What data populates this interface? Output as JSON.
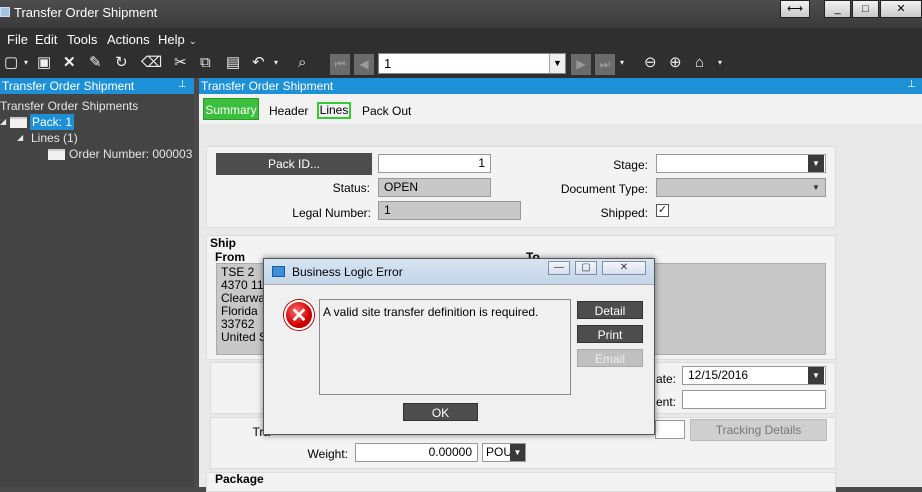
{
  "window": {
    "title": "Transfer Order Shipment",
    "controls": {
      "resize": "⟷",
      "minimize": "_",
      "maximize": "□",
      "close": "✕"
    }
  },
  "menu": [
    "File",
    "Edit",
    "Tools",
    "Actions",
    "Help"
  ],
  "toolbar": {
    "record_value": "1"
  },
  "tree": {
    "header": "Transfer Order Shipment",
    "root": "Transfer Order Shipments",
    "pack": "Pack: 1",
    "lines": "Lines (1)",
    "order": "Order Number: 000003"
  },
  "panel": {
    "header": "Transfer Order Shipment",
    "tabs": [
      "Summary",
      "Header",
      "Lines",
      "Pack Out"
    ]
  },
  "form": {
    "packid_button": "Pack ID...",
    "packid_value": "1",
    "status_label": "Status:",
    "status_value": "OPEN",
    "legal_label": "Legal Number:",
    "legal_value": "1",
    "stage_label": "Stage:",
    "stage_value": "",
    "doctype_label": "Document Type:",
    "doctype_value": "",
    "shipped_label": "Shipped:",
    "shipped_checked": true,
    "ship_section": "Ship",
    "from_label": "From",
    "to_label": "To",
    "from_address": [
      "TSE 2",
      "4370 112",
      "Clearwa",
      "Florida",
      "33762",
      "United S"
    ],
    "date_label_partial": "ate:",
    "date_value": "12/15/2016",
    "ent_label_partial": "ent:",
    "tracking_label_partial": "Tra",
    "tracking_details_button": "Tracking Details",
    "weight_label": "Weight:",
    "weight_value": "0.00000",
    "weight_unit": "POU",
    "package_section": "Package"
  },
  "dialog": {
    "title": "Business Logic Error",
    "message": "A valid site transfer definition is required.",
    "buttons": {
      "detail": "Detail",
      "print": "Print",
      "email": "Email",
      "ok": "OK"
    }
  }
}
